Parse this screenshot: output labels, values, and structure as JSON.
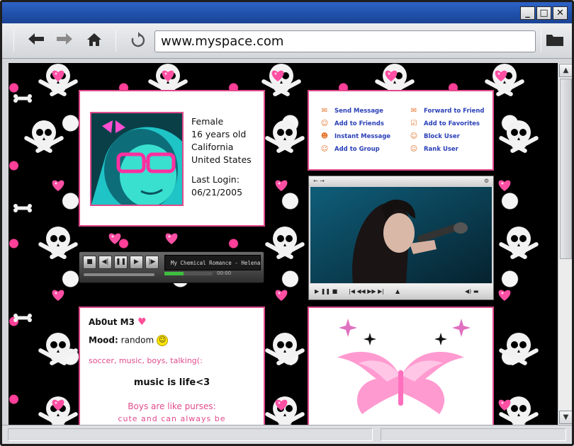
{
  "browser": {
    "url": "www.myspace.com",
    "window_controls": {
      "minimize": "_",
      "maximize": "□",
      "close": "✕"
    },
    "toolbar_icons": [
      "back-arrow-icon",
      "forward-arrow-icon",
      "home-icon",
      "refresh-icon",
      "folder-icon"
    ]
  },
  "profile": {
    "gender": "Female",
    "age": "16 years old",
    "state": "California",
    "country": "United States",
    "last_login_label": "Last Login:",
    "last_login_date": "06/21/2005"
  },
  "contact_links": {
    "left": [
      "Send Message",
      "Add to Friends",
      "Instant Message",
      "Add to Group"
    ],
    "right": [
      "Forward to Friend",
      "Add to Favorites",
      "Block User",
      "Rank User"
    ]
  },
  "music_player": {
    "now_playing": "My Chemical Romance - Helena",
    "time": "00:00"
  },
  "about": {
    "title": "Ab0ut M3",
    "mood_label": "Mood:",
    "mood_value": "random",
    "interests": "soccer, music, boys, talking(:",
    "motto": "music is life<3",
    "quote_line1": "Boys are like purses:",
    "quote_line2": "cute and can always be"
  },
  "colors": {
    "accent": "#e04a8c",
    "link": "#2b40b8",
    "titlebar": "#2458b8"
  }
}
